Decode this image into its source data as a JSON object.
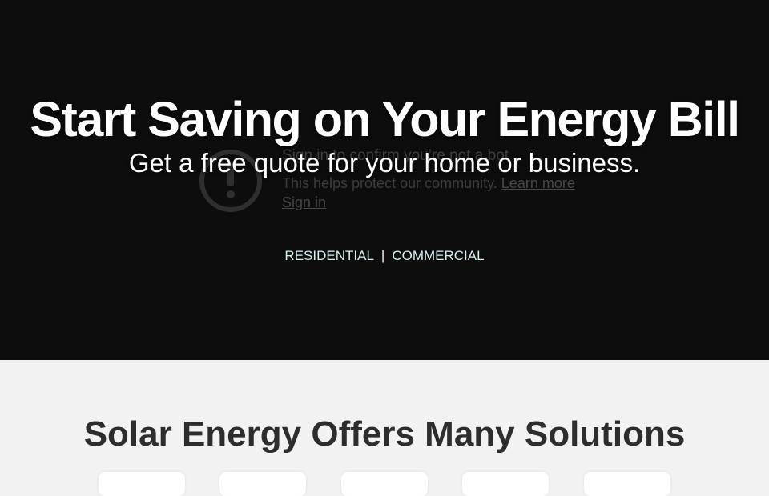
{
  "hero": {
    "title": "Start Saving on Your Energy Bill",
    "subtitle": "Get a free quote for your home or business.",
    "links": {
      "residential": "RESIDENTIAL",
      "separator": "|",
      "commercial": "COMMERCIAL"
    },
    "background_color": "#0d0d0e"
  },
  "embed_notice": {
    "icon": "exclamation-circle-icon",
    "title": "Sign in to confirm you’re not a bot",
    "text": "This helps protect our community.",
    "learn_more": "Learn more",
    "sign_in": "Sign in"
  },
  "solutions": {
    "title": "Solar Energy Offers Many Solutions",
    "card_count": 5,
    "background_color": "#f2f2f2"
  }
}
